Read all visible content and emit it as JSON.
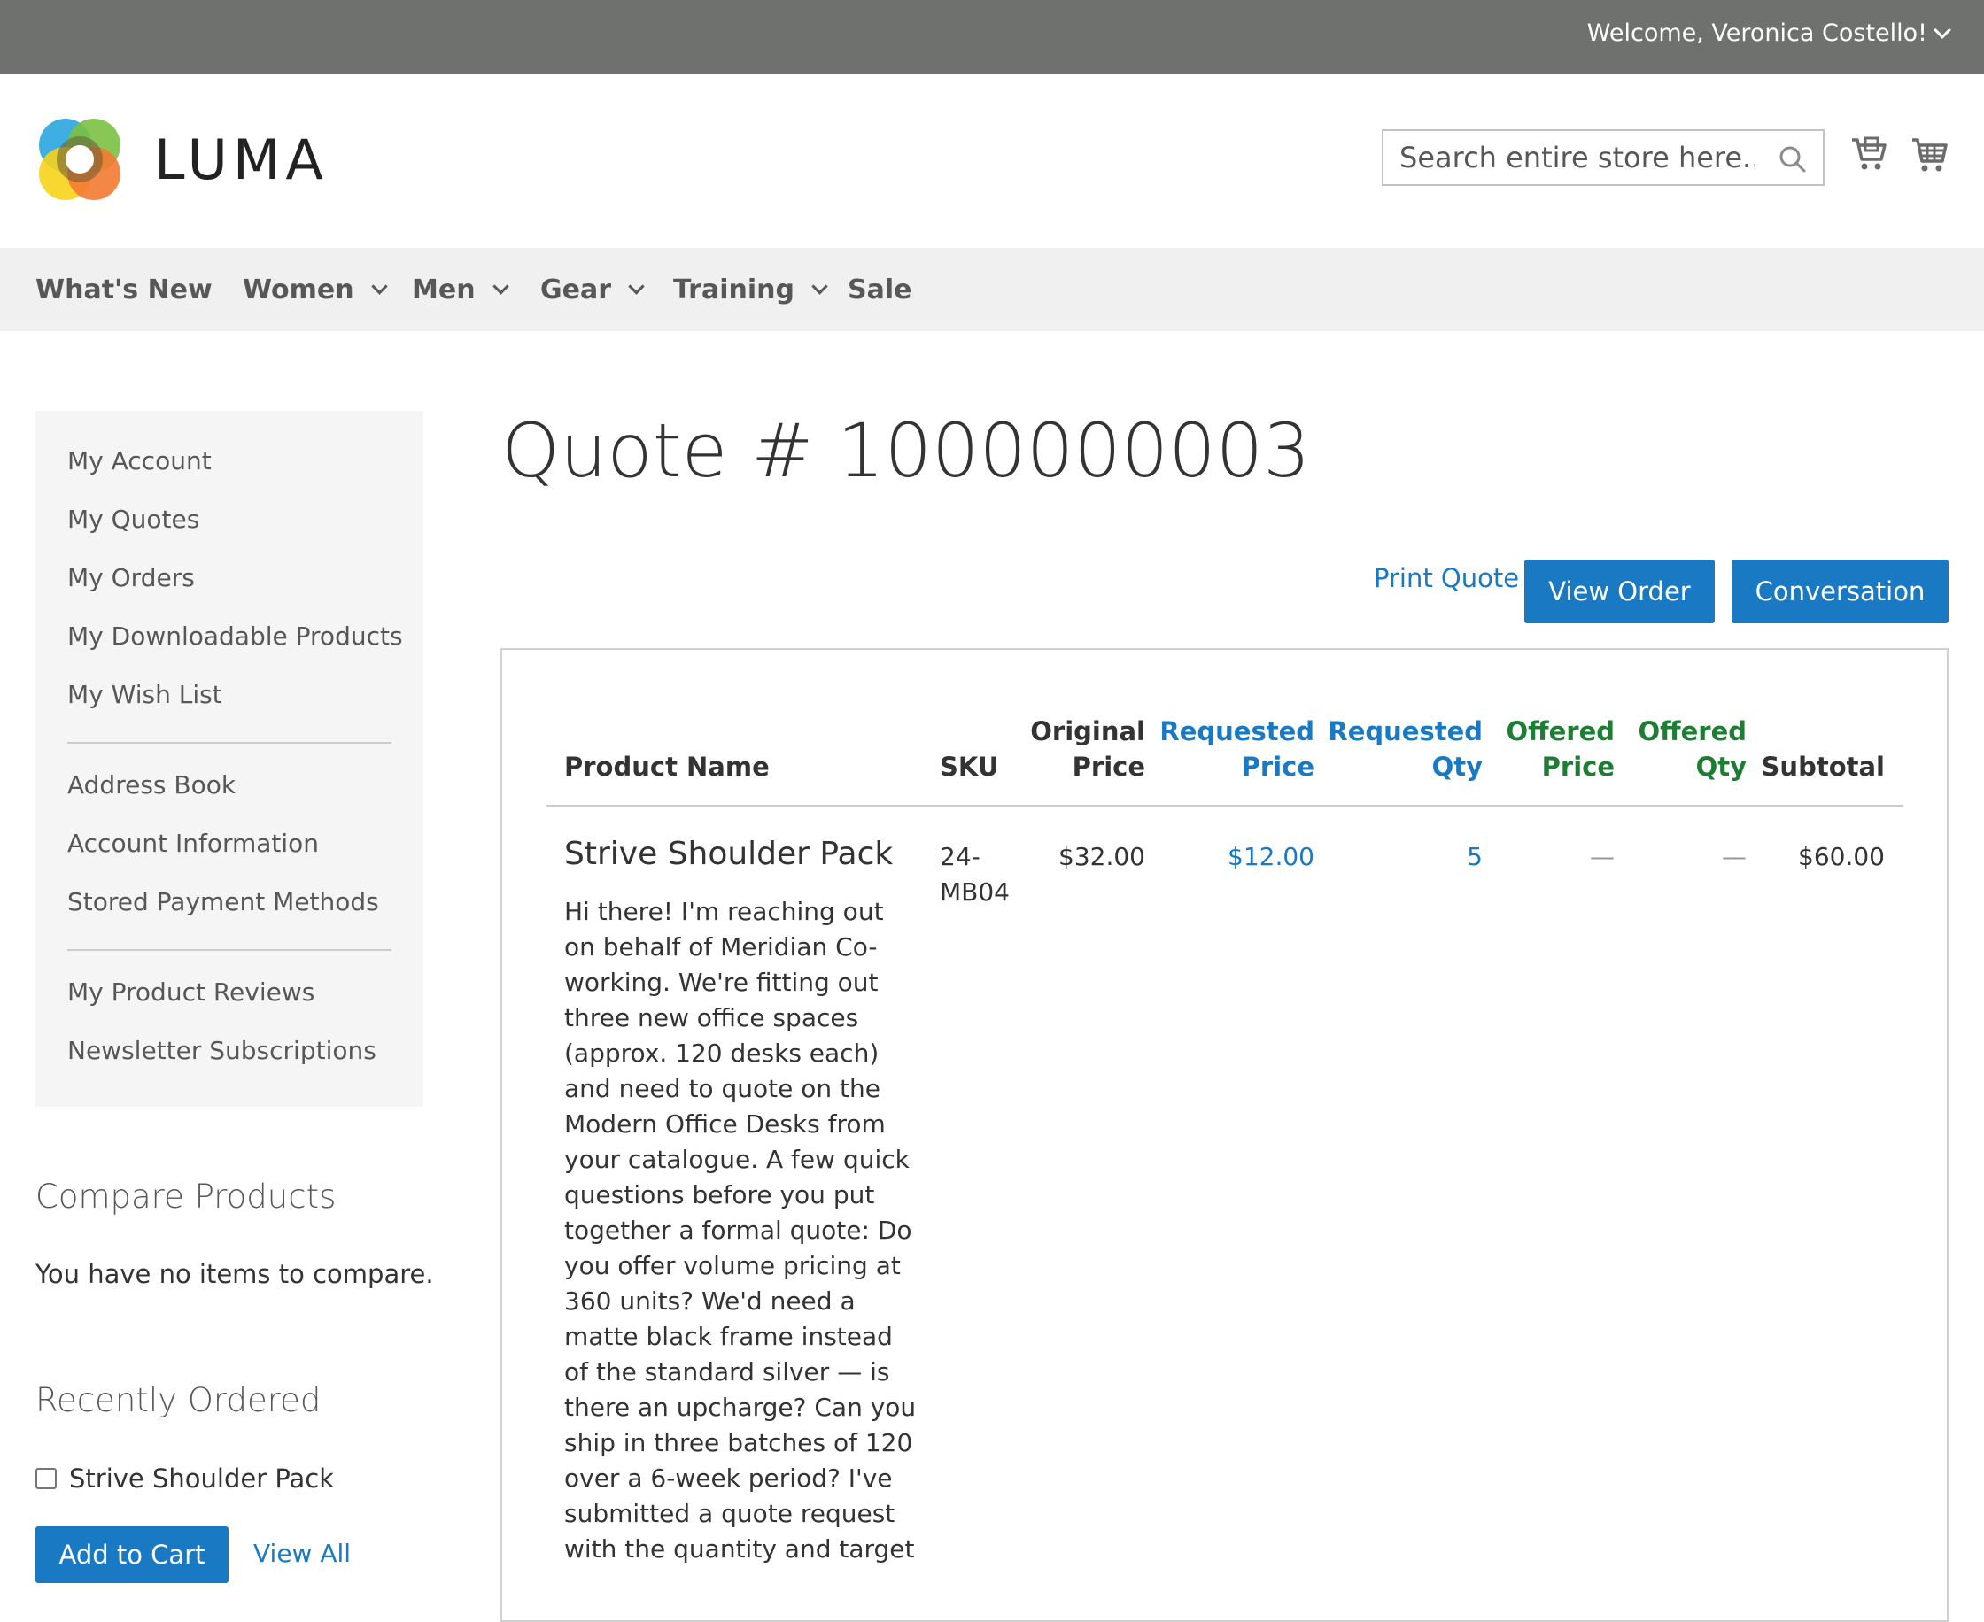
{
  "topbar": {
    "welcome": "Welcome, Veronica Costello!"
  },
  "header": {
    "logo_text": "LUMA",
    "search_placeholder": "Search entire store here..."
  },
  "nav": {
    "items": [
      {
        "label": "What's New"
      },
      {
        "label": "Women"
      },
      {
        "label": "Men"
      },
      {
        "label": "Gear"
      },
      {
        "label": "Training"
      },
      {
        "label": "Sale"
      }
    ]
  },
  "sidebar": {
    "group1": [
      "My Account",
      "My Quotes",
      "My Orders",
      "My Downloadable Products",
      "My Wish List"
    ],
    "group2": [
      "Address Book",
      "Account Information",
      "Stored Payment Methods"
    ],
    "group3": [
      "My Product Reviews",
      "Newsletter Subscriptions"
    ]
  },
  "compare": {
    "title": "Compare Products",
    "empty_text": "You have no items to compare."
  },
  "recent": {
    "title": "Recently Ordered",
    "item": "Strive Shoulder Pack",
    "add_to_cart": "Add to Cart",
    "view_all": "View All"
  },
  "main": {
    "title": "Quote # 1000000003",
    "print_quote": "Print Quote",
    "view_order": "View Order",
    "conversation": "Conversation"
  },
  "table": {
    "headers": {
      "product_name": "Product Name",
      "sku": "SKU",
      "original_price_1": "Original",
      "original_price_2": "Price",
      "requested_price_1": "Requested",
      "requested_price_2": "Price",
      "requested_qty_1": "Requested",
      "requested_qty_2": "Qty",
      "offered_price_1": "Offered",
      "offered_price_2": "Price",
      "offered_qty_1": "Offered",
      "offered_qty_2": "Qty",
      "subtotal": "Subtotal"
    },
    "row": {
      "product_name": "Strive Shoulder Pack",
      "note": "Hi there! I'm reaching out on behalf of Meridian Co-working. We're fitting out three new office spaces (approx. 120 desks each) and need to quote on the Modern Office Desks from your catalogue. A few quick questions before you put together a formal quote: Do you offer volume pricing at 360 units? We'd need a matte black frame instead of the standard silver — is there an upcharge? Can you ship in three batches of 120 over a 6-week period? I've submitted a quote request with the quantity and target",
      "sku_1": "24-",
      "sku_2": "MB04",
      "original_price": "$32.00",
      "requested_price": "$12.00",
      "requested_qty": "5",
      "offered_price": "—",
      "offered_qty": "—",
      "subtotal": "$60.00"
    }
  },
  "colors": {
    "topbar": "#6e716e",
    "nav_bg": "#f0f0f0",
    "primary": "#1979c3",
    "offered": "#1d7e33"
  }
}
